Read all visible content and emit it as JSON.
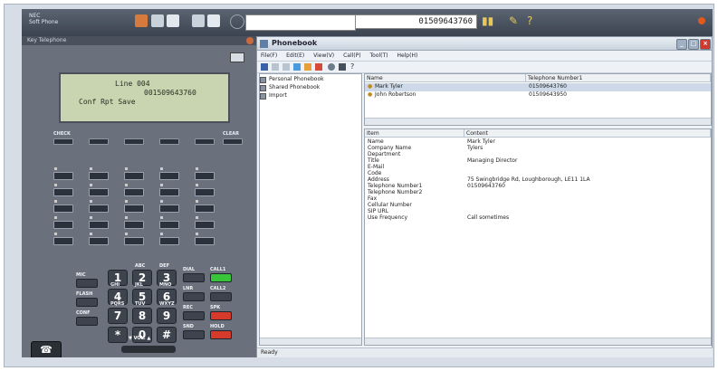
{
  "phone": {
    "brand_line1": "NEC",
    "brand_line2": "Soft Phone",
    "panel_title": "Key Telephone",
    "dial_number": "01509643760",
    "lcd": {
      "line1": "Line 004",
      "line2": "001509643760",
      "line3": "Conf  Rpt  Save"
    },
    "softkeys": {
      "check": "CHECK",
      "clear": "CLEAR"
    },
    "keys": [
      "1",
      "2",
      "3",
      "4",
      "5",
      "6",
      "7",
      "8",
      "9",
      "*",
      "0",
      "#"
    ],
    "key_letters": {
      "2": "ABC",
      "3": "DEF",
      "4": "GHI",
      "5": "JKL",
      "6": "MNO",
      "7": "PQRS",
      "8": "TUV",
      "9": "WXYZ"
    },
    "fn_left": [
      "MIC",
      "FLASH",
      "CONF"
    ],
    "fn_right": [
      "DIAL",
      "CALL1",
      "LNR",
      "CALL2",
      "REC",
      "SPK",
      "HOLD",
      "SND"
    ],
    "vol_label": "▼ VOL. ▲",
    "colors": {
      "call1_led": "#39c53a",
      "hold": "#d63a2a",
      "spk": "#d63a2a"
    }
  },
  "phonebook": {
    "title": "Phonebook",
    "menus": [
      "File(F)",
      "Edit(E)",
      "View(V)",
      "Call(P)",
      "Tool(T)",
      "Help(H)"
    ],
    "tree": [
      "Personal Phonebook",
      "Shared Phonebook",
      "Import"
    ],
    "list_columns": [
      "Name",
      "Telephone Number1"
    ],
    "list_rows": [
      {
        "name": "Mark Tyler",
        "tel": "01509643760"
      },
      {
        "name": "John Robertson",
        "tel": "01509643950"
      }
    ],
    "detail_columns": [
      "Item",
      "Content"
    ],
    "details": [
      {
        "item": "Name",
        "content": "Mark Tyler"
      },
      {
        "item": "Company Name",
        "content": "Tylers"
      },
      {
        "item": "Department",
        "content": ""
      },
      {
        "item": "Title",
        "content": "Managing Director"
      },
      {
        "item": "E-Mail",
        "content": ""
      },
      {
        "item": "Code",
        "content": ""
      },
      {
        "item": "Address",
        "content": "75 Swingbridge Rd, Loughborough, LE11 1LA"
      },
      {
        "item": "Telephone Number1",
        "content": "01509643760"
      },
      {
        "item": "Telephone Number2",
        "content": ""
      },
      {
        "item": "Fax",
        "content": ""
      },
      {
        "item": "Cellular Number",
        "content": ""
      },
      {
        "item": "SIP URL",
        "content": ""
      },
      {
        "item": "Use Frequency",
        "content": "Call sometimes"
      }
    ],
    "status": "Ready"
  }
}
